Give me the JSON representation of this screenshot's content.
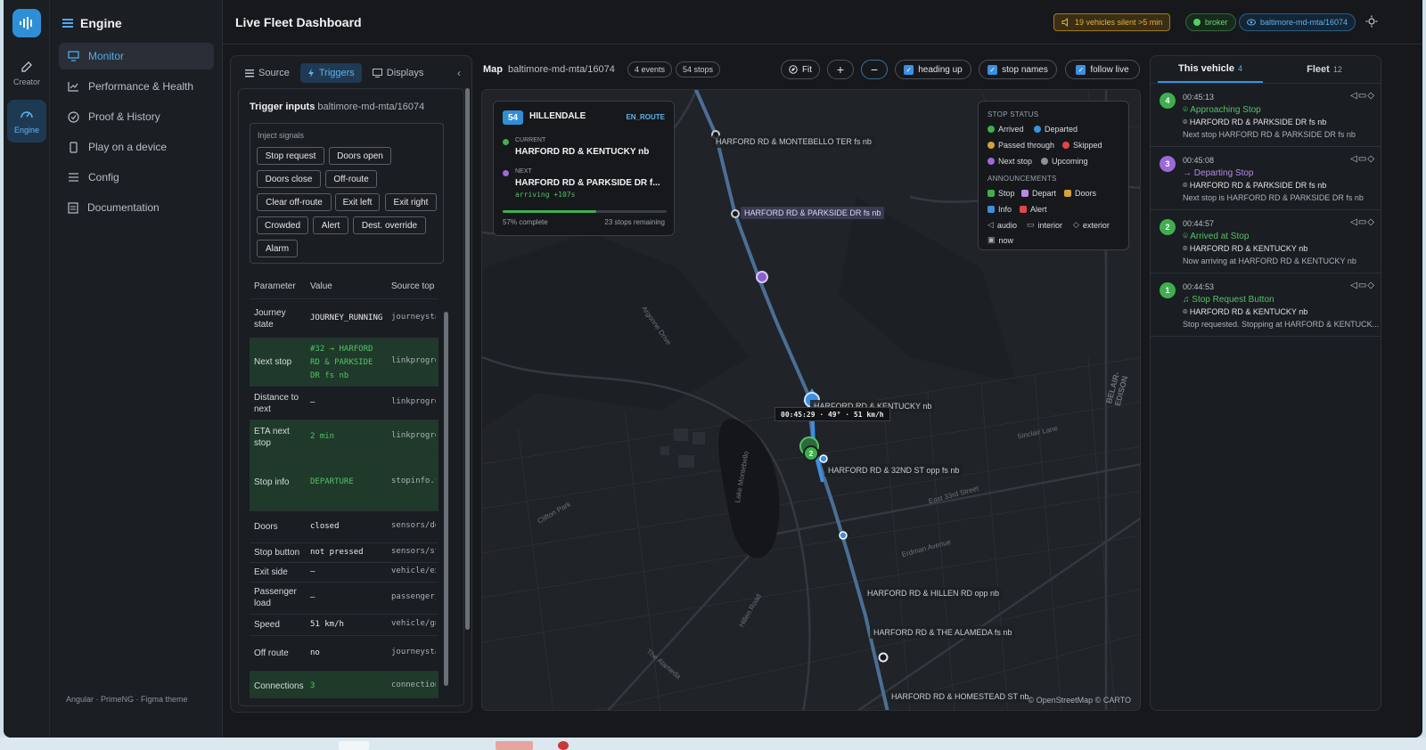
{
  "rail": {
    "items": [
      {
        "label": "Creator",
        "icon": "edit-icon"
      },
      {
        "label": "Engine",
        "icon": "gauge-icon"
      }
    ]
  },
  "sidebar": {
    "title": "Engine",
    "items": [
      {
        "label": "Monitor",
        "icon": "monitor-icon"
      },
      {
        "label": "Performance & Health",
        "icon": "chart-icon"
      },
      {
        "label": "Proof & History",
        "icon": "check-circle-icon"
      },
      {
        "label": "Play on a device",
        "icon": "device-icon"
      },
      {
        "label": "Config",
        "icon": "sliders-icon"
      },
      {
        "label": "Documentation",
        "icon": "document-icon"
      }
    ],
    "footer": "Angular · PrimeNG · Figma theme"
  },
  "header": {
    "title": "Live Fleet Dashboard",
    "warning": "19 vehicles silent >5 min",
    "broker": "broker",
    "route": "baltimore-md-mta/16074"
  },
  "left_panel": {
    "tabs": [
      "Source",
      "Triggers",
      "Displays"
    ],
    "trigger_title": "Trigger inputs",
    "trigger_route": "baltimore-md-mta/16074",
    "inject_label": "Inject signals",
    "signals": [
      "Stop request",
      "Doors open",
      "Doors close",
      "Off-route",
      "Clear off-route",
      "Exit left",
      "Exit right",
      "Crowded",
      "Alert",
      "Dest. override",
      "Alarm"
    ],
    "table_headers": [
      "Parameter",
      "Value",
      "Source top"
    ],
    "rows": [
      {
        "param": "Journey state",
        "value": "JOURNEY_RUNNING",
        "source": "journeysta"
      },
      {
        "param": "Next stop",
        "value": "#32 → HARFORD RD & PARKSIDE DR fs nb",
        "source": "linkprogre"
      },
      {
        "param": "Distance to next",
        "value": "—",
        "source": "linkprogre"
      },
      {
        "param": "ETA next stop",
        "value": "2 min",
        "source": "linkprogre"
      },
      {
        "param": "Stop info",
        "value": "DEPARTURE",
        "source": "stopinfo.t"
      },
      {
        "param": "Doors",
        "value": "closed",
        "source": "sensors/do"
      },
      {
        "param": "Stop button",
        "value": "not pressed",
        "source": "sensors/st"
      },
      {
        "param": "Exit side",
        "value": "—",
        "source": "vehicle/ex"
      },
      {
        "param": "Passenger load",
        "value": "—",
        "source": "passenger_"
      },
      {
        "param": "Speed",
        "value": "51 km/h",
        "source": "vehicle/gn"
      },
      {
        "param": "Off route",
        "value": "no",
        "source": "journeysta"
      },
      {
        "param": "Connections",
        "value": "3",
        "source": "connection"
      }
    ]
  },
  "map_toolbar": {
    "label": "Map",
    "route": "baltimore-md-mta/16074",
    "events": "4 events",
    "stops": "54 stops",
    "fit": "Fit",
    "zoom_in": "+",
    "zoom_out": "−",
    "heading_up": "heading up",
    "stop_names": "stop names",
    "follow_live": "follow live"
  },
  "vehicle_card": {
    "route": "54",
    "destination": "HILLENDALE",
    "status": "EN_ROUTE",
    "current_label": "CURRENT",
    "current_stop": "HARFORD RD & KENTUCKY nb",
    "next_label": "NEXT",
    "next_stop": "HARFORD RD & PARKSIDE DR f...",
    "arriving": "arriving +107s",
    "progress_fraction": 0.57,
    "progress_text": "57% complete",
    "remaining": "23 stops remaining"
  },
  "legend": {
    "stop_status_title": "STOP STATUS",
    "arrived": "Arrived",
    "departed": "Departed",
    "passed": "Passed through",
    "skipped": "Skipped",
    "next_stop": "Next stop",
    "upcoming": "Upcoming",
    "announcements_title": "ANNOUNCEMENTS",
    "stop": "Stop",
    "depart": "Depart",
    "doors": "Doors",
    "info": "Info",
    "alert": "Alert",
    "audio": "audio",
    "interior": "interior",
    "exterior": "exterior",
    "now": "now"
  },
  "map": {
    "stops": [
      "HARFORD RD & MONTEBELLO TER fs nb",
      "HARFORD RD & PARKSIDE DR fs nb",
      "HARFORD RD & KENTUCKY nb",
      "HARFORD RD & 32ND ST opp fs nb",
      "HARFORD RD & HILLEN RD opp nb",
      "HARFORD RD & THE ALAMEDA fs nb",
      "HARFORD RD & HOMESTEAD ST nb"
    ],
    "vehicle_tooltip": "00:45:29 · 49° · 51 km/h",
    "cluster_count": "2",
    "attribution": "© OpenStreetMap © CARTO",
    "streets": [
      "Lake Montebello",
      "BELAIR-EDISON",
      "Erdman Avenue",
      "Hillen Road",
      "The Alameda",
      "Argonne Drive",
      "Sinclair Lane",
      "Clifton Park",
      "East 33rd Street"
    ]
  },
  "right_panel": {
    "tab_vehicle": "This vehicle",
    "tab_vehicle_count": "4",
    "tab_fleet": "Fleet",
    "tab_fleet_count": "12",
    "events": [
      {
        "num": "4",
        "time": "00:45:13",
        "title": "Approaching Stop",
        "loc": "HARFORD RD & PARKSIDE DR fs nb",
        "desc": "Next stop HARFORD RD & PARKSIDE DR fs nb",
        "color": "#3fae4f"
      },
      {
        "num": "3",
        "time": "00:45:08",
        "title": "Departing Stop",
        "loc": "HARFORD RD & PARKSIDE DR fs nb",
        "desc": "Next stop is HARFORD RD & PARKSIDE DR fs nb",
        "color": "#9b6ad8"
      },
      {
        "num": "2",
        "time": "00:44:57",
        "title": "Arrived at Stop",
        "loc": "HARFORD RD & KENTUCKY nb",
        "desc": "Now arriving at HARFORD RD & KENTUCKY nb",
        "color": "#3fae4f"
      },
      {
        "num": "1",
        "time": "00:44:53",
        "title": "Stop Request Button",
        "loc": "HARFORD RD & KENTUCKY nb",
        "desc": "Stop requested. Stopping at HARFORD & KENTUCK...",
        "color": "#3fae4f"
      }
    ]
  },
  "colors": {
    "accent": "#3d8fe0",
    "green": "#55c267",
    "purple": "#9b6ad8",
    "warning": "#e4b240"
  }
}
